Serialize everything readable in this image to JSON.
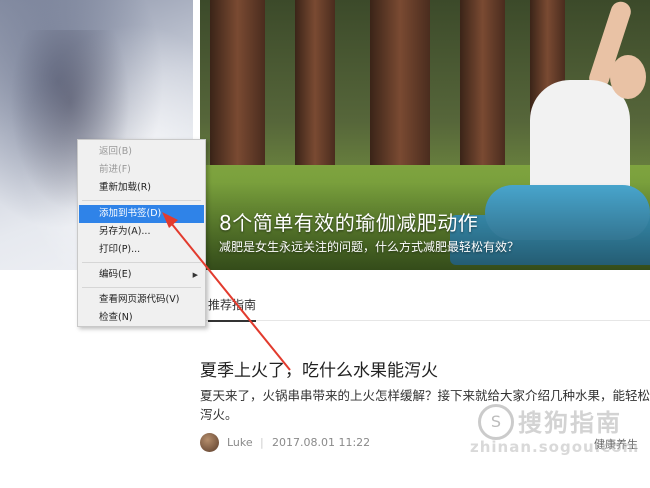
{
  "hero": {
    "title": "8个简单有效的瑜伽减肥动作",
    "subtitle": "减肥是女生永远关注的问题，什么方式减肥最轻松有效？"
  },
  "tabs": [
    {
      "label": "推荐指南",
      "active": true
    }
  ],
  "article": {
    "title": "夏季上火了，吃什么水果能泻火",
    "summary": "夏天来了，火锅串串带来的上火怎样缓解？接下来就给大家介绍几种水果，能轻松泻火。",
    "author": "Luke",
    "separator": "|",
    "date": "2017.08.01 11:22",
    "category": "健康养生"
  },
  "context_menu": {
    "items": [
      {
        "label": "返回(B)",
        "disabled": true
      },
      {
        "label": "前进(F)",
        "disabled": true
      },
      {
        "label": "重新加载(R)",
        "disabled": false
      },
      {
        "label": "添加到书签(D)",
        "disabled": false,
        "highlighted": true
      },
      {
        "label": "另存为(A)...",
        "disabled": false
      },
      {
        "label": "打印(P)...",
        "disabled": false
      },
      {
        "label": "编码(E)",
        "disabled": false,
        "submenu": true
      },
      {
        "label": "查看网页源代码(V)",
        "disabled": false
      },
      {
        "label": "检查(N)",
        "disabled": false
      }
    ],
    "submenu_arrow": "▶"
  },
  "watermark": {
    "logo_glyph": "S",
    "text": "搜狗指南",
    "url": "zhinan.sogou.com"
  },
  "colors": {
    "highlight": "#2f83e8",
    "arrow": "#e23b2e"
  }
}
